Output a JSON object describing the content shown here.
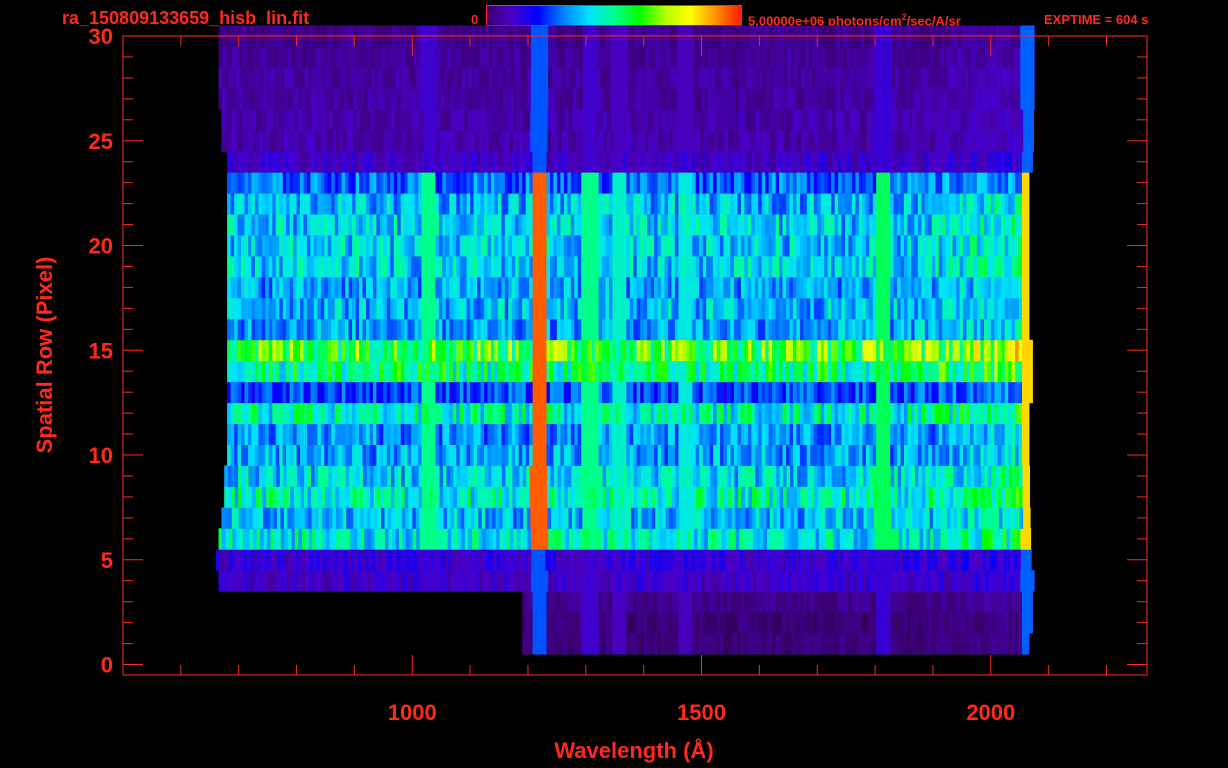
{
  "header": {
    "filename": "ra_150809133659_hisb_lin.fit",
    "colorbar_min_label": "0",
    "colorbar_max_value": "5.00000e+06",
    "colorbar_max_unit_pre": "photons/cm",
    "colorbar_max_unit_sup": "2",
    "colorbar_max_unit_post": "/sec/A/sr",
    "exptime": "EXPTIME = 604 s"
  },
  "colors": {
    "axis": "#ff2a1a",
    "background": "#000000"
  },
  "chart_data": {
    "type": "heatmap",
    "colormap": [
      "#000000",
      "#3a0070",
      "#4a00c8",
      "#0000ff",
      "#0080ff",
      "#00e0ff",
      "#00ff90",
      "#00ff00",
      "#b0ff00",
      "#ffff00",
      "#ff9000",
      "#ff1a00"
    ],
    "value_range": [
      0,
      5000000
    ],
    "xlabel": "Wavelength (Å)",
    "ylabel": "Spatial Row (Pixel)",
    "xlim": [
      500,
      2270
    ],
    "ylim": [
      -0.5,
      30
    ],
    "x_ticks": [
      1000,
      1500,
      2000
    ],
    "x_tick_labels": [
      "1000",
      "1500",
      "2000"
    ],
    "x_minor_step": 100,
    "y_ticks": [
      0,
      5,
      10,
      15,
      20,
      25,
      30
    ],
    "y_tick_labels": [
      "0",
      "5",
      "10",
      "15",
      "20",
      "25",
      "30"
    ],
    "y_minor_step": 1,
    "row_extent": [
      {
        "row": 1,
        "x_start": 1190,
        "x_end": 2065,
        "level": 0.1
      },
      {
        "row": 2,
        "x_start": 1190,
        "x_end": 2070,
        "level": 0.1
      },
      {
        "row": 3,
        "x_start": 1190,
        "x_end": 2070,
        "level": 0.12
      },
      {
        "row": 4,
        "x_start": 665,
        "x_end": 2070,
        "level": 0.18
      },
      {
        "row": 5,
        "x_start": 660,
        "x_end": 2070,
        "level": 0.2
      },
      {
        "row": 6,
        "x_start": 665,
        "x_end": 2065,
        "level": 0.48
      },
      {
        "row": 7,
        "x_start": 670,
        "x_end": 2065,
        "level": 0.42
      },
      {
        "row": 8,
        "x_start": 675,
        "x_end": 2065,
        "level": 0.5
      },
      {
        "row": 9,
        "x_start": 675,
        "x_end": 2065,
        "level": 0.45
      },
      {
        "row": 10,
        "x_start": 680,
        "x_end": 2065,
        "level": 0.4
      },
      {
        "row": 11,
        "x_start": 680,
        "x_end": 2065,
        "level": 0.38
      },
      {
        "row": 12,
        "x_start": 680,
        "x_end": 2065,
        "level": 0.5
      },
      {
        "row": 13,
        "x_start": 680,
        "x_end": 2070,
        "level": 0.32
      },
      {
        "row": 14,
        "x_start": 680,
        "x_end": 2070,
        "level": 0.55
      },
      {
        "row": 15,
        "x_start": 680,
        "x_end": 2070,
        "level": 0.65
      },
      {
        "row": 16,
        "x_start": 680,
        "x_end": 2065,
        "level": 0.4
      },
      {
        "row": 17,
        "x_start": 680,
        "x_end": 2065,
        "level": 0.42
      },
      {
        "row": 18,
        "x_start": 680,
        "x_end": 2065,
        "level": 0.4
      },
      {
        "row": 19,
        "x_start": 680,
        "x_end": 2065,
        "level": 0.44
      },
      {
        "row": 20,
        "x_start": 680,
        "x_end": 2065,
        "level": 0.44
      },
      {
        "row": 21,
        "x_start": 680,
        "x_end": 2065,
        "level": 0.44
      },
      {
        "row": 22,
        "x_start": 680,
        "x_end": 2065,
        "level": 0.42
      },
      {
        "row": 23,
        "x_start": 680,
        "x_end": 2065,
        "level": 0.35
      },
      {
        "row": 24,
        "x_start": 680,
        "x_end": 2070,
        "level": 0.18
      },
      {
        "row": 25,
        "x_start": 670,
        "x_end": 2070,
        "level": 0.15
      },
      {
        "row": 26,
        "x_start": 670,
        "x_end": 2070,
        "level": 0.15
      },
      {
        "row": 27,
        "x_start": 665,
        "x_end": 2070,
        "level": 0.14
      },
      {
        "row": 28,
        "x_start": 665,
        "x_end": 2070,
        "level": 0.14
      },
      {
        "row": 29,
        "x_start": 665,
        "x_end": 2070,
        "level": 0.13
      },
      {
        "row": 30,
        "x_start": 665,
        "x_end": 2070,
        "level": 0.12
      }
    ],
    "emission_lines": [
      {
        "wavelength": 1216,
        "level": 0.95
      },
      {
        "wavelength": 1026,
        "level": 0.55
      },
      {
        "wavelength": 1304,
        "level": 0.55
      },
      {
        "wavelength": 1356,
        "level": 0.5
      },
      {
        "wavelength": 1470,
        "level": 0.48
      },
      {
        "wavelength": 1810,
        "level": 0.58
      }
    ]
  }
}
